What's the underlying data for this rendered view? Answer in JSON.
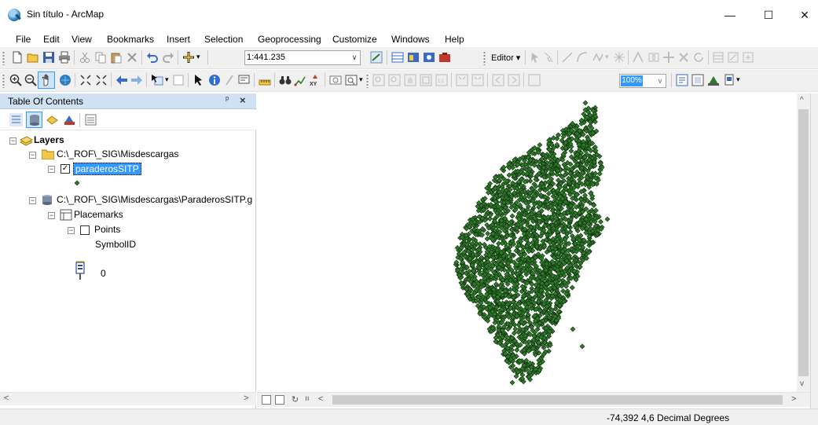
{
  "window": {
    "title": "Sin título - ArcMap",
    "controls": {
      "minimize": "—",
      "maximize": "☐",
      "close": "✕"
    }
  },
  "menu": [
    "File",
    "Edit",
    "View",
    "Bookmarks",
    "Insert",
    "Selection",
    "Geoprocessing",
    "Customize",
    "Windows",
    "Help"
  ],
  "toolbar": {
    "scale_value": "1:441.235",
    "editor_label": "Editor ▾",
    "zoom_value": "100%"
  },
  "toc": {
    "title": "Table Of Contents",
    "pin": "ᵖ",
    "close": "×",
    "layers_root": "Layers",
    "folder_path": "C:\\_ROF\\_SIG\\Misdescargas",
    "layer_name": "paraderosSITP",
    "kml_path": "C:\\_ROF\\_SIG\\Misdescargas\\ParaderosSITP.g",
    "placemarks": "Placemarks",
    "points": "Points",
    "symbol_field": "SymbolID",
    "symbol_value": "0"
  },
  "status": {
    "coords": "-74,392  4,6 Decimal Degrees"
  },
  "colors": {
    "point_fill": "#2f7a2a",
    "point_stroke": "#0d2e0b",
    "selection": "#3399ff",
    "toc_header": "#cfe1f3"
  }
}
